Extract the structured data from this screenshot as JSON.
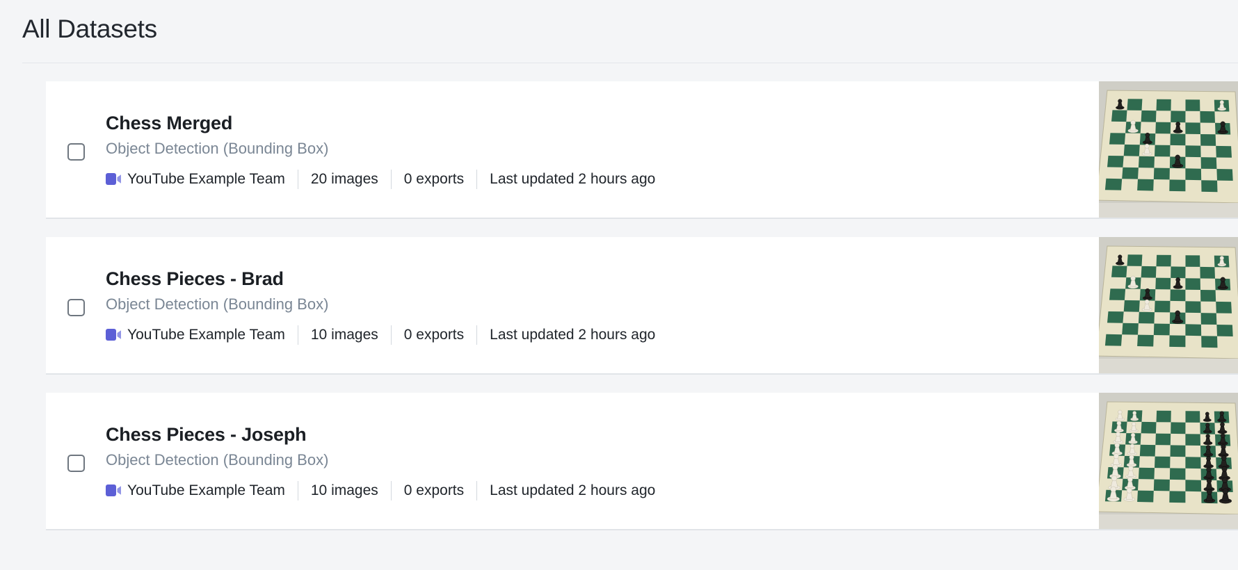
{
  "header": {
    "title": "All Datasets"
  },
  "colors": {
    "page_background": "#f4f5f7",
    "card_background": "#ffffff",
    "title_text": "#22272e",
    "dataset_name_text": "#1b1f24",
    "dataset_type_text": "#7a8694",
    "meta_text": "#20252b",
    "workspace_icon": "#5c5fd6",
    "divider": "#e3e6ea",
    "card_border": "#e1e4e8",
    "checkbox_border": "#6e767f",
    "board_dark": "#2f6b4f",
    "board_light": "#e8e3c8",
    "piece_black": "#22201e",
    "piece_white": "#efeade"
  },
  "datasets": [
    {
      "name": "Chess Merged",
      "type": "Object Detection (Bounding Box)",
      "workspace": "YouTube Example Team",
      "workspace_icon": "video-camera-icon",
      "images": "20 images",
      "exports": "0 exports",
      "updated": "Last updated 2 hours ago",
      "checkbox_checked": false,
      "thumbnail": "chessboard-sparse-photo"
    },
    {
      "name": "Chess Pieces - Brad",
      "type": "Object Detection (Bounding Box)",
      "workspace": "YouTube Example Team",
      "workspace_icon": "video-camera-icon",
      "images": "10 images",
      "exports": "0 exports",
      "updated": "Last updated 2 hours ago",
      "checkbox_checked": false,
      "thumbnail": "chessboard-sparse-photo"
    },
    {
      "name": "Chess Pieces - Joseph",
      "type": "Object Detection (Bounding Box)",
      "workspace": "YouTube Example Team",
      "workspace_icon": "video-camera-icon",
      "images": "10 images",
      "exports": "0 exports",
      "updated": "Last updated 2 hours ago",
      "checkbox_checked": false,
      "thumbnail": "chessboard-start-position-photo"
    }
  ]
}
